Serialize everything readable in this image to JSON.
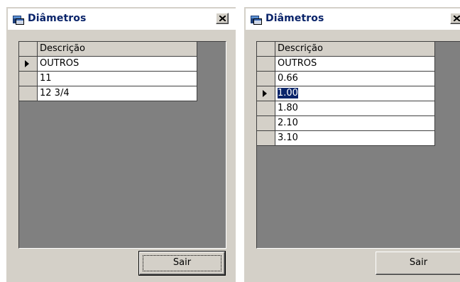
{
  "windows": [
    {
      "title": "Diâmetros",
      "column_header": "Descrição",
      "rows": [
        "OUTROS",
        "11",
        "12 3/4"
      ],
      "current_row_index": 0,
      "close_symbol": "×",
      "button_label": "Sair"
    },
    {
      "title": "Diâmetros",
      "column_header": "Descrição",
      "rows": [
        "OUTROS",
        "0.66",
        "1.00",
        "1.80",
        "2.10",
        "3.10"
      ],
      "current_row_index": 2,
      "close_symbol": "×",
      "button_label": "Sair"
    }
  ],
  "colors": {
    "title_text": "#0a246a",
    "face": "#d4d0c8",
    "grid_background": "#808080",
    "selection": "#0a246a"
  },
  "icons": [
    "app-window-icon",
    "close-icon",
    "current-row-arrow-icon"
  ]
}
